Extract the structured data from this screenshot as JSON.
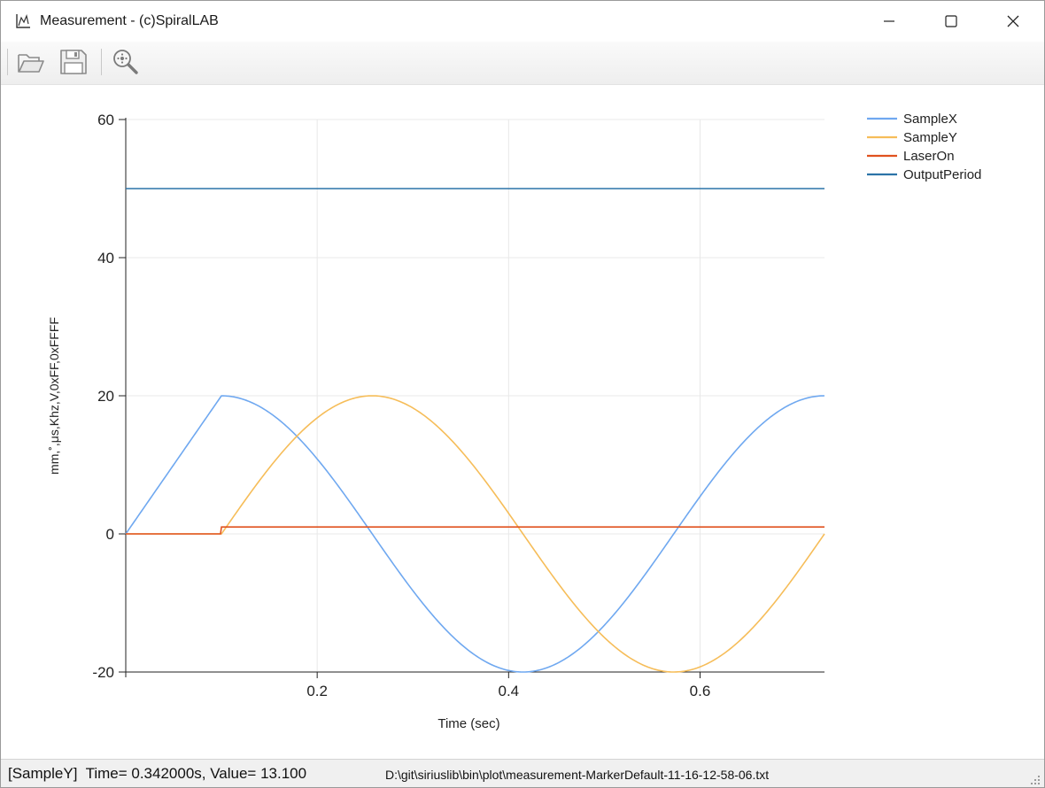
{
  "window": {
    "title": "Measurement - (c)SpiralLAB",
    "icon": "chart-icon",
    "controls": [
      "minimize-icon",
      "maximize-icon",
      "close-icon"
    ]
  },
  "toolbar": {
    "buttons": [
      {
        "name": "open-button",
        "icon": "folder-open-icon"
      },
      {
        "name": "save-button",
        "icon": "save-icon"
      },
      {
        "name": "zoom-button",
        "icon": "zoom-icon"
      }
    ]
  },
  "status": {
    "marker_text": "[SampleY]  Time= 0.342000s, Value= 13.100",
    "file_path": "D:\\git\\siriuslib\\bin\\plot\\measurement-MarkerDefault-11-16-12-58-06.txt"
  },
  "chart_data": {
    "type": "line",
    "xlabel": "Time (sec)",
    "ylabel": "mm,˚,μs,Khz,V,0xFF,0xFFFF",
    "xlim": [
      0,
      0.73
    ],
    "ylim": [
      -20,
      60
    ],
    "xticks": [
      "0.2",
      "0.4",
      "0.6"
    ],
    "xtick_values": [
      0.2,
      0.4,
      0.6
    ],
    "yticks": [
      "60",
      "40",
      "20",
      "0",
      "-20"
    ],
    "ytick_values": [
      60,
      40,
      20,
      0,
      -20
    ],
    "grid": true,
    "legend_position": "top-right",
    "series": [
      {
        "name": "SampleX",
        "color": "#6fa8f0",
        "x": [
          0,
          0.1,
          0.14,
          0.18,
          0.22,
          0.26,
          0.3,
          0.34,
          0.38,
          0.414,
          0.45,
          0.49,
          0.53,
          0.57,
          0.61,
          0.65,
          0.69,
          0.73
        ],
        "y": [
          0,
          20,
          18.1,
          12.7,
          4.8,
          -3.6,
          -11.4,
          -17.2,
          -19.9,
          -20,
          -17.8,
          -12.4,
          -4.6,
          3.9,
          11.7,
          17.5,
          19.9,
          20
        ]
      },
      {
        "name": "SampleY",
        "color": "#f6bd59",
        "x": [
          0,
          0.1,
          0.14,
          0.18,
          0.22,
          0.258,
          0.3,
          0.34,
          0.38,
          0.42,
          0.46,
          0.5,
          0.54,
          0.578,
          0.61,
          0.65,
          0.69,
          0.73
        ],
        "y": [
          0,
          0,
          7.6,
          14.1,
          18.6,
          20,
          18.2,
          13.1,
          5.9,
          -1.8,
          -9.5,
          -15.5,
          -19.4,
          -20,
          -18.6,
          -13.9,
          -7.2,
          0
        ]
      },
      {
        "name": "LaserOn",
        "color": "#e0521f",
        "x": [
          0,
          0.099,
          0.1,
          0.73
        ],
        "y": [
          0,
          0,
          1,
          1
        ]
      },
      {
        "name": "OutputPeriod",
        "color": "#2c73a8",
        "x": [
          0,
          0.73
        ],
        "y": [
          50,
          50
        ]
      }
    ]
  }
}
